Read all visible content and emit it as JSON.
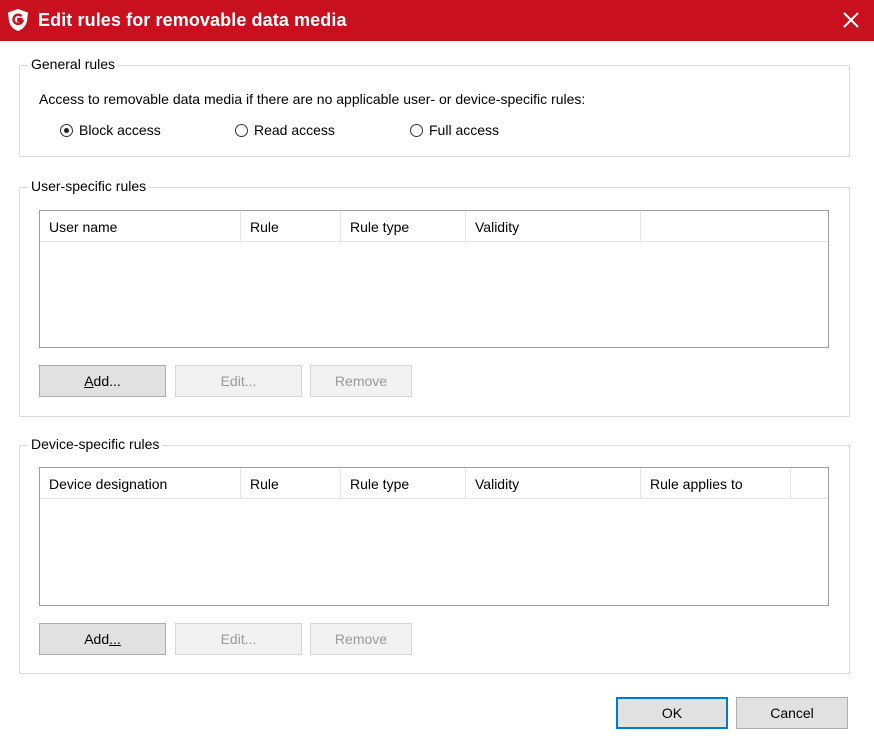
{
  "window": {
    "title": "Edit rules for removable data media",
    "accent_color": "#c8101e"
  },
  "general": {
    "legend": "General rules",
    "description": "Access to removable data media if there are no applicable user- or device-specific rules:",
    "options": [
      {
        "label": "Block access",
        "selected": true
      },
      {
        "label": "Read access",
        "selected": false
      },
      {
        "label": "Full access",
        "selected": false
      }
    ]
  },
  "user_rules": {
    "legend": "User-specific rules",
    "columns": [
      "User name",
      "Rule",
      "Rule type",
      "Validity"
    ],
    "rows": [],
    "buttons": {
      "add_mnemonic": "A",
      "add_rest": "dd...",
      "edit": "Edit...",
      "remove": "Remove"
    }
  },
  "device_rules": {
    "legend": "Device-specific rules",
    "columns": [
      "Device designation",
      "Rule",
      "Rule type",
      "Validity",
      "Rule applies to"
    ],
    "rows": [],
    "buttons": {
      "add_main": "Add",
      "add_mnemonic": "...",
      "edit": "Edit...",
      "remove": "Remove"
    }
  },
  "footer": {
    "ok": "OK",
    "cancel": "Cancel"
  }
}
